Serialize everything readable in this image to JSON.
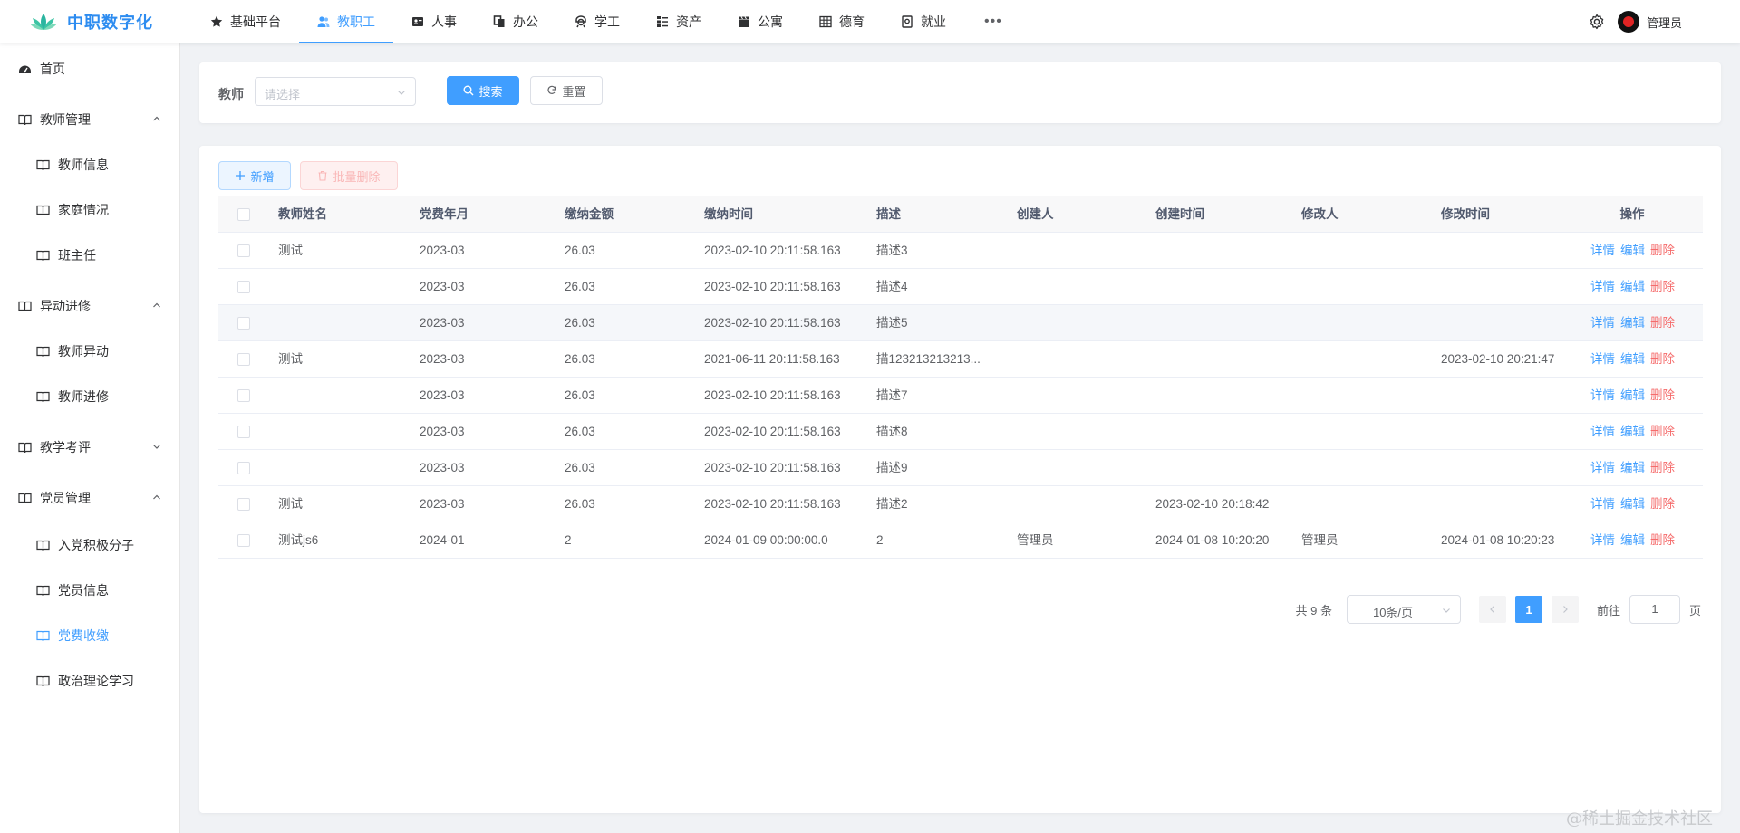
{
  "app": {
    "title": "中职数字化"
  },
  "topnav": [
    {
      "label": "基础平台",
      "icon": "star-icon",
      "active": false
    },
    {
      "label": "教职工",
      "icon": "users-icon",
      "active": true
    },
    {
      "label": "人事",
      "icon": "id-card-icon",
      "active": false
    },
    {
      "label": "办公",
      "icon": "copy-icon",
      "active": false
    },
    {
      "label": "学工",
      "icon": "student-icon",
      "active": false
    },
    {
      "label": "资产",
      "icon": "list-tree-icon",
      "active": false
    },
    {
      "label": "公寓",
      "icon": "clapperboard-icon",
      "active": false
    },
    {
      "label": "德育",
      "icon": "grid-icon",
      "active": false
    },
    {
      "label": "就业",
      "icon": "badge-icon",
      "active": false
    }
  ],
  "user": {
    "name": "管理员"
  },
  "sidebar": {
    "home": "首页",
    "groups": [
      {
        "label": "教师管理",
        "expanded": true,
        "items": [
          "教师信息",
          "家庭情况",
          "班主任"
        ]
      },
      {
        "label": "异动进修",
        "expanded": true,
        "items": [
          "教师异动",
          "教师进修"
        ]
      },
      {
        "label": "教学考评",
        "expanded": false,
        "items": []
      },
      {
        "label": "党员管理",
        "expanded": true,
        "items": [
          "入党积极分子",
          "党员信息",
          "党费收缴",
          "政治理论学习"
        ]
      }
    ],
    "active_item": "党费收缴"
  },
  "search": {
    "teacher_label": "教师",
    "teacher_placeholder": "请选择",
    "search_btn": "搜索",
    "reset_btn": "重置"
  },
  "toolbar": {
    "add_btn": "新增",
    "batch_delete_btn": "批量删除"
  },
  "table": {
    "columns": [
      "教师姓名",
      "党费年月",
      "缴纳金额",
      "缴纳时间",
      "描述",
      "创建人",
      "创建时间",
      "修改人",
      "修改时间",
      "操作"
    ],
    "rows": [
      {
        "name": "测试",
        "month": "2023-03",
        "amount": "26.03",
        "pay_time": "2023-02-10 20:11:58.163",
        "desc": "描述3",
        "creator": "",
        "create_time": "",
        "modifier": "",
        "modify_time": ""
      },
      {
        "name": "",
        "month": "2023-03",
        "amount": "26.03",
        "pay_time": "2023-02-10 20:11:58.163",
        "desc": "描述4",
        "creator": "",
        "create_time": "",
        "modifier": "",
        "modify_time": ""
      },
      {
        "name": "",
        "month": "2023-03",
        "amount": "26.03",
        "pay_time": "2023-02-10 20:11:58.163",
        "desc": "描述5",
        "creator": "",
        "create_time": "",
        "modifier": "",
        "modify_time": ""
      },
      {
        "name": "测试",
        "month": "2023-03",
        "amount": "26.03",
        "pay_time": "2021-06-11 20:11:58.163",
        "desc": "描123213213213...",
        "creator": "",
        "create_time": "",
        "modifier": "",
        "modify_time": "2023-02-10 20:21:47"
      },
      {
        "name": "",
        "month": "2023-03",
        "amount": "26.03",
        "pay_time": "2023-02-10 20:11:58.163",
        "desc": "描述7",
        "creator": "",
        "create_time": "",
        "modifier": "",
        "modify_time": ""
      },
      {
        "name": "",
        "month": "2023-03",
        "amount": "26.03",
        "pay_time": "2023-02-10 20:11:58.163",
        "desc": "描述8",
        "creator": "",
        "create_time": "",
        "modifier": "",
        "modify_time": ""
      },
      {
        "name": "",
        "month": "2023-03",
        "amount": "26.03",
        "pay_time": "2023-02-10 20:11:58.163",
        "desc": "描述9",
        "creator": "",
        "create_time": "",
        "modifier": "",
        "modify_time": ""
      },
      {
        "name": "测试",
        "month": "2023-03",
        "amount": "26.03",
        "pay_time": "2023-02-10 20:11:58.163",
        "desc": "描述2",
        "creator": "",
        "create_time": "2023-02-10 20:18:42",
        "modifier": "",
        "modify_time": ""
      },
      {
        "name": "测试js6",
        "month": "2024-01",
        "amount": "2",
        "pay_time": "2024-01-09 00:00:00.0",
        "desc": "2",
        "creator": "管理员",
        "create_time": "2024-01-08 10:20:20",
        "modifier": "管理员",
        "modify_time": "2024-01-08 10:20:23"
      }
    ],
    "row_actions": [
      "详情",
      "编辑",
      "删除"
    ],
    "highlighted_row": 2
  },
  "pagination": {
    "total_text": "共 9 条",
    "page_size": "10条/页",
    "current_page": "1",
    "goto_label": "前往",
    "goto_value": "1",
    "page_suffix": "页"
  },
  "watermark": "@稀土掘金技术社区",
  "colors": {
    "primary": "#409eff",
    "danger": "#f56c6c",
    "logo": "#2d8cf0"
  }
}
